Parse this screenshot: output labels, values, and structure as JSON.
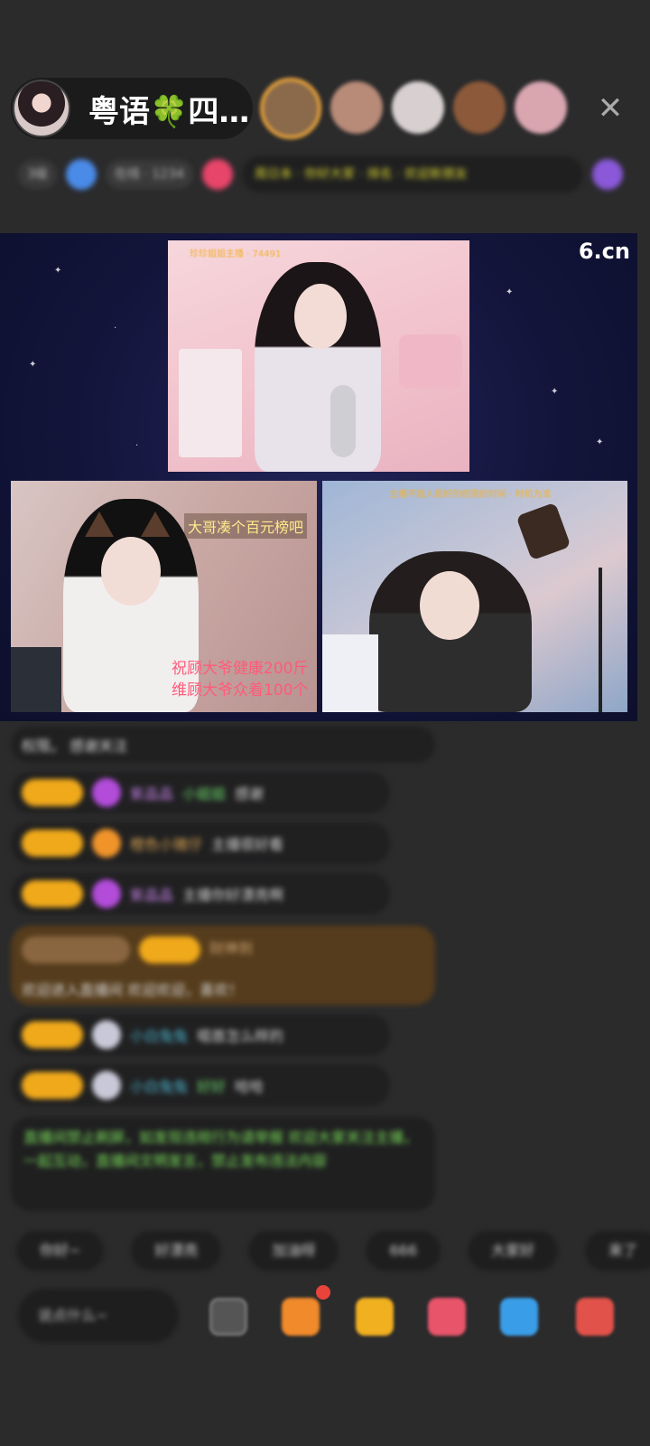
{
  "header": {
    "host_name": "粤语🍀四…",
    "close_icon": "close-icon",
    "viewer_avatars": [
      {
        "name": "viewer-avatar-1",
        "color": "#8a6a4a"
      },
      {
        "name": "viewer-avatar-2",
        "color": "#b88a78"
      },
      {
        "name": "viewer-avatar-3",
        "color": "#d8d0d0"
      },
      {
        "name": "viewer-avatar-4",
        "color": "#8c5a3a"
      },
      {
        "name": "viewer-avatar-5",
        "color": "#d9a6b0"
      }
    ]
  },
  "info_row": {
    "chip1": "3级",
    "chip2": "在线 · 1234",
    "banner": "周日本 · 你好大家 · 排名 · 欢迎新朋友"
  },
  "stage": {
    "logo": "6.cn",
    "main_cam_tag": "珍珍姐姐主播 · 74491",
    "right_cam_tag": "主播不错人挺好的权限的时间 · 时机为准",
    "left_board_text": "大哥凑个百元榜吧",
    "left_wish_text": "祝顾大爷健康200斤\n维顾大爷众着100个"
  },
  "chat": {
    "messages": [
      {
        "type": "plain",
        "text": "权限。 感谢关注"
      },
      {
        "type": "user",
        "user": "紫晶晶",
        "text": "感谢",
        "prefix": "小姐姐"
      },
      {
        "type": "user",
        "user": "橙色小猪仔",
        "text": "主播很好看"
      },
      {
        "type": "user",
        "user": "紫晶晶",
        "text": "主播你好漂亮啊"
      },
      {
        "type": "system",
        "user": "财神到",
        "text": "欢迎进入直播间 欢迎欢迎，喜欢！"
      },
      {
        "type": "user",
        "user": "小白兔兔",
        "text": "唱首怎么样的"
      },
      {
        "type": "user",
        "user": "小白兔兔",
        "text": "哈哈",
        "prefix": "好好"
      },
      {
        "type": "notice",
        "text": "直播间禁止刷屏，如发现违规行为请举报 欢迎大家关注主播，一起互动，直播间文明发言，禁止发布违法内容"
      }
    ]
  },
  "quick_replies": [
    "你好~",
    "好漂亮",
    "加油呀",
    "666",
    "大家好",
    "来了"
  ],
  "bottom_bar": {
    "input_placeholder": "说点什么~",
    "icons": [
      {
        "name": "emoji-icon",
        "color": "#5a5a5a"
      },
      {
        "name": "gift-box-icon",
        "color": "#f08a2a"
      },
      {
        "name": "treasure-icon",
        "color": "#f0b020"
      },
      {
        "name": "heart-gift-icon",
        "color": "#e8556a"
      },
      {
        "name": "game-icon",
        "color": "#3a9de8"
      },
      {
        "name": "more-gift-icon",
        "color": "#e0524a"
      }
    ]
  }
}
